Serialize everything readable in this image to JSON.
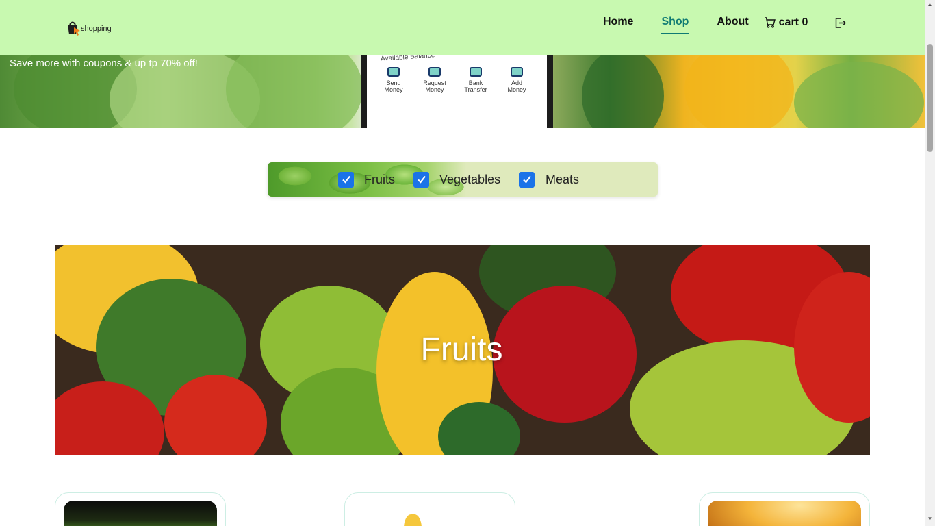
{
  "header": {
    "logo_text": "shopping",
    "nav": {
      "home": "Home",
      "shop": "Shop",
      "about": "About"
    },
    "cart_label": "cart 0",
    "active_nav": "Shop"
  },
  "hero": {
    "promo_text": "Save more with coupons & up tp 70% off!",
    "phone": {
      "title": "Available Balance",
      "actions": [
        "Send Money",
        "Request Money",
        "Bank Transfer",
        "Add Money"
      ]
    }
  },
  "filter": {
    "options": [
      {
        "label": "Fruits",
        "checked": true
      },
      {
        "label": "Vegetables",
        "checked": true
      },
      {
        "label": "Meats",
        "checked": true
      }
    ]
  },
  "category_banner": {
    "title": "Fruits"
  },
  "colors": {
    "header_bg": "#c8f9b0",
    "nav_active": "#0f7a73",
    "checkbox": "#1a73e8",
    "filter_bg": "#dfeabc",
    "card_border": "#cdeee4"
  },
  "icons": {
    "logo": "shopping-bag-cursor-icon",
    "cart": "cart-icon",
    "logout": "logout-icon",
    "checkbox": "check-icon"
  }
}
